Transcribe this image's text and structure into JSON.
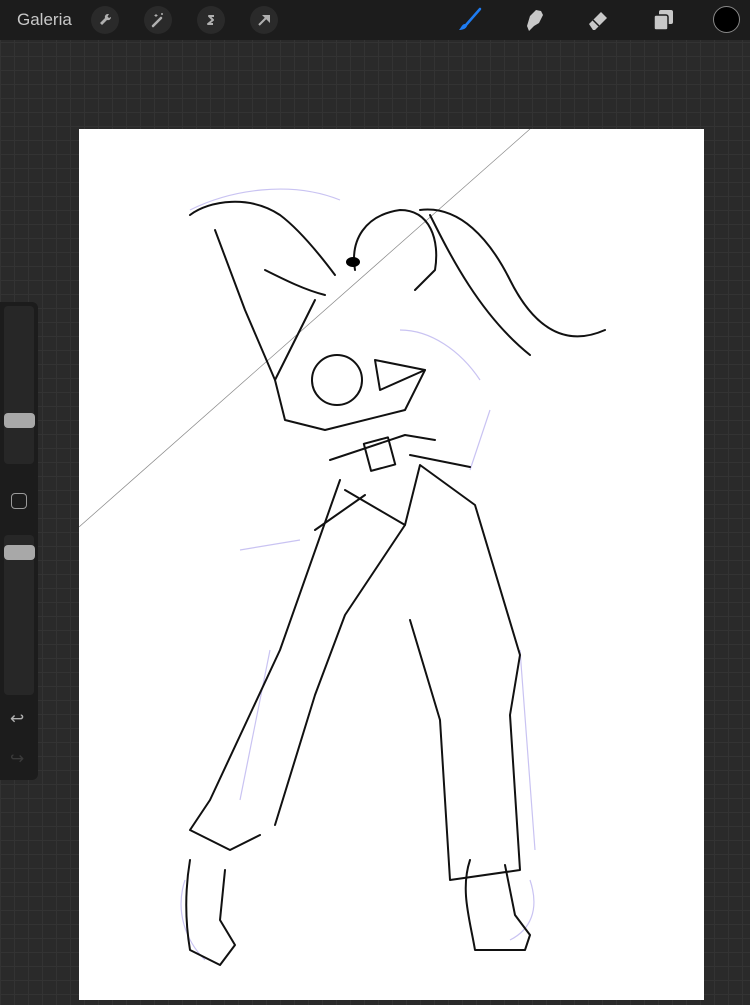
{
  "topbar": {
    "gallery_label": "Galeria",
    "left_tools": [
      "wrench-icon",
      "magic-wand-icon",
      "selection-icon",
      "transform-arrow-icon"
    ],
    "right_tools": [
      "brush-icon",
      "smudge-icon",
      "eraser-icon",
      "layers-icon"
    ],
    "active_tool": "brush",
    "accent_color": "#1e7cf2",
    "current_color": "#000000"
  },
  "sidebar": {
    "brush_size_percent": 25,
    "opacity_percent": 93,
    "buttons": [
      "modify-button",
      "undo-icon",
      "redo-icon"
    ]
  }
}
